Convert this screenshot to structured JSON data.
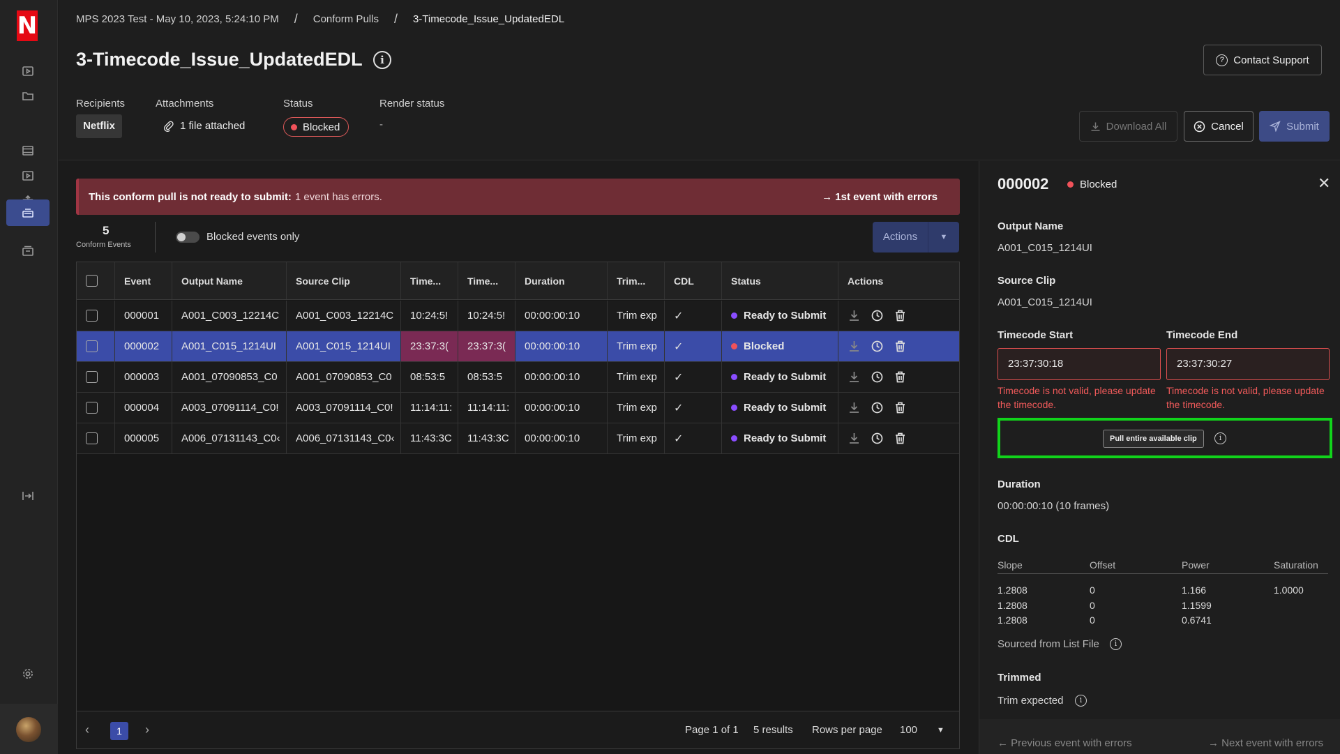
{
  "sidebar": {
    "logo": "N",
    "icons": [
      "play-icon",
      "folder-icon",
      "film-icon",
      "media-icon",
      "upload-icon",
      "conform-icon",
      "archive-icon",
      "collapse-icon",
      "settings-icon"
    ]
  },
  "breadcrumb": {
    "items": [
      "MPS 2023 Test - May 10, 2023, 5:24:10 PM",
      "Conform Pulls",
      "3-Timecode_Issue_UpdatedEDL"
    ],
    "separator": "/"
  },
  "header": {
    "title": "3-Timecode_Issue_UpdatedEDL",
    "contact_support": "Contact Support",
    "recipients_label": "Recipients",
    "recipients_value": "Netflix",
    "attachments_label": "Attachments",
    "attachments_value": "1 file attached",
    "status_label": "Status",
    "status_value": "Blocked",
    "render_label": "Render status",
    "render_value": "-",
    "download_all": "Download All",
    "cancel": "Cancel",
    "submit": "Submit"
  },
  "banner": {
    "bold": "This conform pull is not ready to submit:",
    "rest": "1 event has errors.",
    "link": "1st event with errors"
  },
  "summary": {
    "count": "5",
    "count_label": "Conform Events",
    "toggle_label": "Blocked events only",
    "actions": "Actions"
  },
  "table": {
    "headers": [
      "Event",
      "Output Name",
      "Source Clip",
      "Time...",
      "Time...",
      "Duration",
      "Trim...",
      "CDL",
      "Status",
      "Actions"
    ],
    "rows": [
      {
        "event": "000001",
        "output": "A001_C003_12214C",
        "source": "A001_C003_12214C",
        "tc1": "10:24:5!",
        "tc2": "10:24:5!",
        "duration": "00:00:00:10",
        "trim": "Trim exp",
        "cdl": "✓",
        "status": "Ready to Submit"
      },
      {
        "event": "000002",
        "output": "A001_C015_1214UI",
        "source": "A001_C015_1214UI",
        "tc1": "23:37:3(",
        "tc2": "23:37:3(",
        "duration": "00:00:00:10",
        "trim": "Trim exp",
        "cdl": "✓",
        "status": "Blocked"
      },
      {
        "event": "000003",
        "output": "A001_07090853_C0",
        "source": "A001_07090853_C0",
        "tc1": "08:53:5",
        "tc2": "08:53:5",
        "duration": "00:00:00:10",
        "trim": "Trim exp",
        "cdl": "✓",
        "status": "Ready to Submit"
      },
      {
        "event": "000004",
        "output": "A003_07091114_C0!",
        "source": "A003_07091114_C0!",
        "tc1": "11:14:11:",
        "tc2": "11:14:11:",
        "duration": "00:00:00:10",
        "trim": "Trim exp",
        "cdl": "✓",
        "status": "Ready to Submit"
      },
      {
        "event": "000005",
        "output": "A006_07131143_C0‹",
        "source": "A006_07131143_C0‹",
        "tc1": "11:43:3C",
        "tc2": "11:43:3C",
        "duration": "00:00:00:10",
        "trim": "Trim exp",
        "cdl": "✓",
        "status": "Ready to Submit"
      }
    ]
  },
  "pagination": {
    "prev": "‹",
    "current": "1",
    "next": "›",
    "page_text": "Page 1 of 1",
    "results": "5 results",
    "rows_label": "Rows per page",
    "rows_value": "100"
  },
  "panel": {
    "id": "000002",
    "status": "Blocked",
    "output_label": "Output Name",
    "output_value": "A001_C015_1214UI",
    "source_label": "Source Clip",
    "source_value": "A001_C015_1214UI",
    "tc_start_label": "Timecode Start",
    "tc_start_value": "23:37:30:18",
    "tc_end_label": "Timecode End",
    "tc_end_value": "23:37:30:27",
    "tc_error": "Timecode is not valid, please update the timecode.",
    "pull_button": "Pull entire available clip",
    "duration_label": "Duration",
    "duration_value": "00:00:00:10 (10 frames)",
    "cdl_label": "CDL",
    "cdl_headers": [
      "Slope",
      "Offset",
      "Power",
      "Saturation"
    ],
    "cdl_rows": [
      [
        "1.2808",
        "0",
        "1.166",
        "1.0000"
      ],
      [
        "1.2808",
        "0",
        "1.1599",
        ""
      ],
      [
        "1.2808",
        "0",
        "0.6741",
        ""
      ]
    ],
    "sourced_from": "Sourced from List File",
    "trimmed_label": "Trimmed",
    "trimmed_value": "Trim expected",
    "prev_errors": "Previous event with errors",
    "next_errors": "Next event with errors"
  },
  "colors": {
    "accent": "#3b4ca8",
    "error": "#f0525a",
    "ready": "#8a4dff",
    "highlight": "#11d31b",
    "netflix_red": "#e50914"
  }
}
